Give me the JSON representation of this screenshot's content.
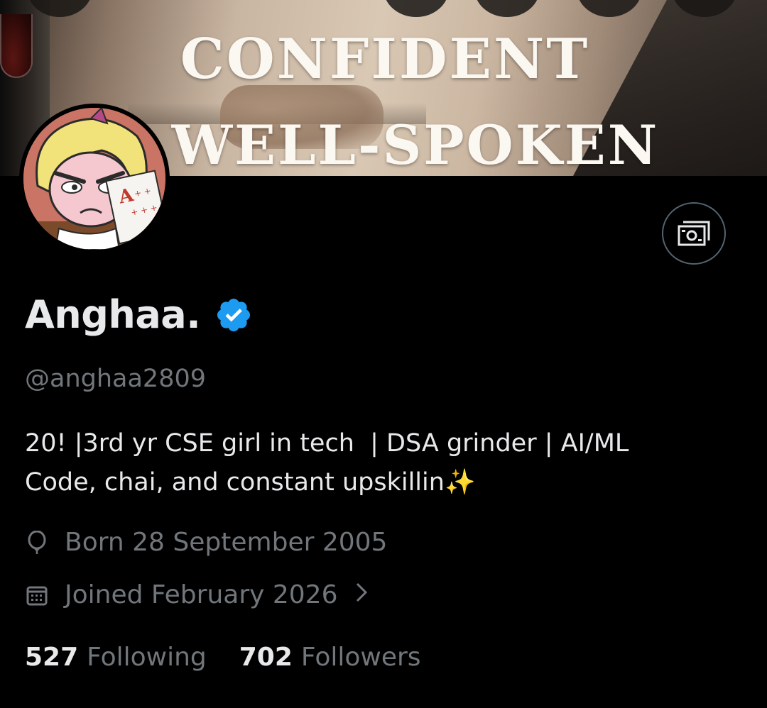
{
  "banner": {
    "line1": "CONFIDENT",
    "line2": "WELL-SPOKEN"
  },
  "profile": {
    "display_name": "Anghaa.",
    "verified": true,
    "handle": "@anghaa2809",
    "bio_line1": "20! |3rd yr CSE girl in tech  | DSA grinder | AI/ML",
    "bio_line2": "Code, chai, and constant upskillin",
    "bio_emoji": "✨",
    "born": "Born 28 September 2005",
    "joined": "Joined February 2026",
    "following_count": "527",
    "following_label": "Following",
    "followers_count": "702",
    "followers_label": "Followers"
  },
  "icons": {
    "verified": "verified-badge-icon",
    "money": "money-icon",
    "birthday": "balloon-icon",
    "calendar": "calendar-icon",
    "chevron": "chevron-right-icon"
  },
  "colors": {
    "background": "#000000",
    "text_primary": "#e7e9ea",
    "text_secondary": "#71767b",
    "verified_blue": "#1d9bf0",
    "border": "#536471"
  }
}
